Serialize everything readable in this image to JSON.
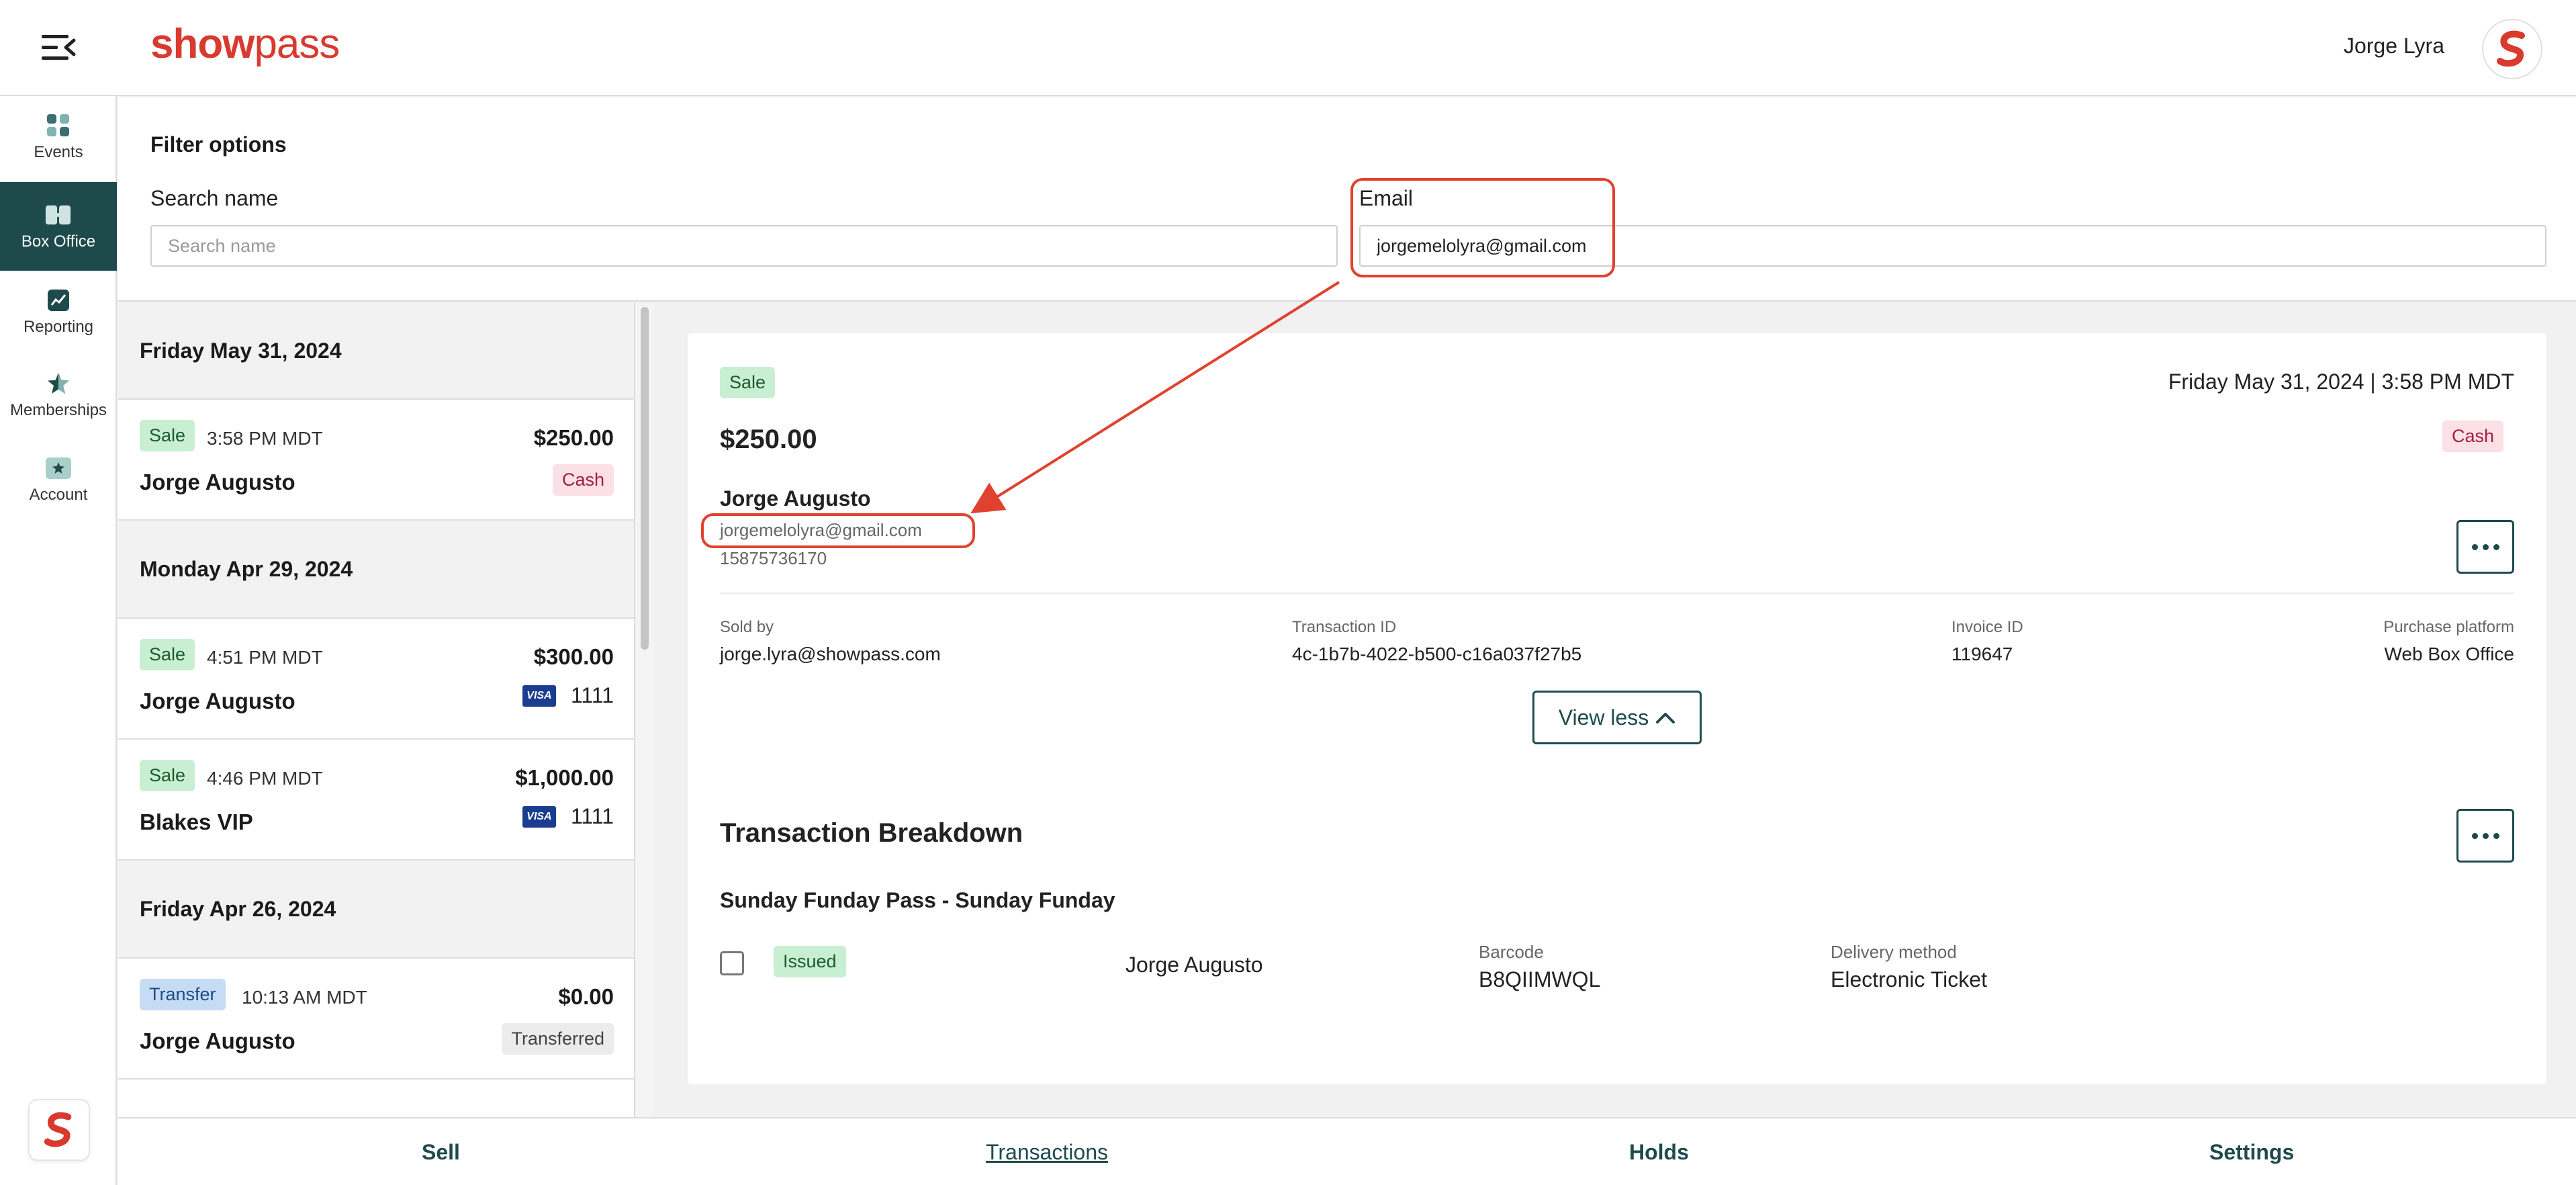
{
  "app": {
    "brand_bold": "show",
    "brand_light": "pass",
    "user_name": "Jorge Lyra"
  },
  "sidebar": {
    "items": [
      {
        "label": "Events",
        "icon": "grid-icon"
      },
      {
        "label": "Box Office",
        "icon": "tickets-icon",
        "active": true
      },
      {
        "label": "Reporting",
        "icon": "chart-icon"
      },
      {
        "label": "Memberships",
        "icon": "star-icon"
      },
      {
        "label": "Account",
        "icon": "account-card-icon"
      }
    ]
  },
  "filter": {
    "title": "Filter options",
    "search_label": "Search name",
    "search_placeholder": "Search name",
    "search_value": "",
    "email_label": "Email",
    "email_value": "jorgemelolyra@gmail.com"
  },
  "transactions": {
    "groups": [
      {
        "date": "Friday May 31, 2024",
        "items": [
          {
            "type": "Sale",
            "time": "3:58 PM MDT",
            "amount": "$250.00",
            "name": "Jorge Augusto",
            "payment": "Cash"
          }
        ]
      },
      {
        "date": "Monday Apr 29, 2024",
        "items": [
          {
            "type": "Sale",
            "time": "4:51 PM MDT",
            "amount": "$300.00",
            "name": "Jorge Augusto",
            "card_last4": "1111"
          },
          {
            "type": "Sale",
            "time": "4:46 PM MDT",
            "amount": "$1,000.00",
            "name": "Blakes VIP",
            "card_last4": "1111"
          }
        ]
      },
      {
        "date": "Friday Apr 26, 2024",
        "items": [
          {
            "type": "Transfer",
            "time": "10:13 AM MDT",
            "amount": "$0.00",
            "name": "Jorge Augusto",
            "payment": "Transferred"
          }
        ]
      }
    ],
    "card_brand": "VISA"
  },
  "detail": {
    "type": "Sale",
    "datetime": "Friday May 31, 2024 | 3:58 PM MDT",
    "amount": "$250.00",
    "payment": "Cash",
    "customer_name": "Jorge Augusto",
    "customer_email": "jorgemelolyra@gmail.com",
    "customer_phone": "15875736170",
    "sold_by_label": "Sold by",
    "sold_by": "jorge.lyra@showpass.com",
    "transaction_id_label": "Transaction ID",
    "transaction_id": "4c-1b7b-4022-b500-c16a037f27b5",
    "invoice_id_label": "Invoice ID",
    "invoice_id": "119647",
    "platform_label": "Purchase platform",
    "platform": "Web Box Office",
    "view_less_label": "View less",
    "breakdown_title": "Transaction Breakdown",
    "item_title": "Sunday Funday Pass - Sunday Funday",
    "ticket": {
      "status": "Issued",
      "holder": "Jorge Augusto",
      "barcode_label": "Barcode",
      "barcode": "B8QIIMWQL",
      "delivery_label": "Delivery method",
      "delivery": "Electronic Ticket"
    }
  },
  "bottom_tabs": [
    {
      "label": "Sell"
    },
    {
      "label": "Transactions",
      "active": true
    },
    {
      "label": "Holds"
    },
    {
      "label": "Settings"
    }
  ],
  "colors": {
    "accent": "#1e4a4c",
    "brand": "#d93a2f",
    "annotation": "#e0422f"
  }
}
